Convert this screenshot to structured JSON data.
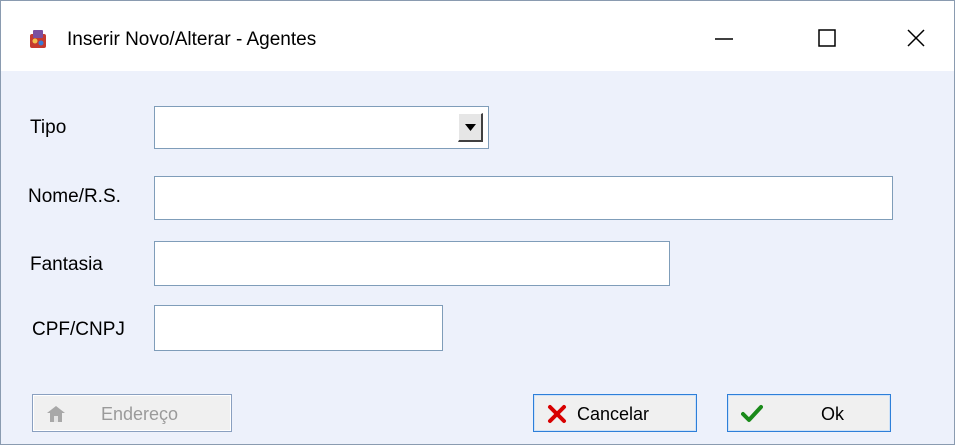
{
  "window": {
    "title": "Inserir Novo/Alterar - Agentes",
    "controls": {
      "minimize": "minimize-icon",
      "maximize": "maximize-icon",
      "close": "close-icon"
    }
  },
  "form": {
    "tipo": {
      "label": "Tipo",
      "value": ""
    },
    "nome": {
      "label": "Nome/R.S.",
      "value": ""
    },
    "fantasia": {
      "label": "Fantasia",
      "value": ""
    },
    "cpf_cnpj": {
      "label": "CPF/CNPJ",
      "value": ""
    }
  },
  "buttons": {
    "endereco": {
      "label": "Endereço",
      "icon": "home-icon",
      "enabled": false
    },
    "cancelar": {
      "label": "Cancelar",
      "icon": "x-icon",
      "color": "#d80000"
    },
    "ok": {
      "label": "Ok",
      "icon": "checkmark-icon",
      "color": "#1a8a1a"
    }
  }
}
